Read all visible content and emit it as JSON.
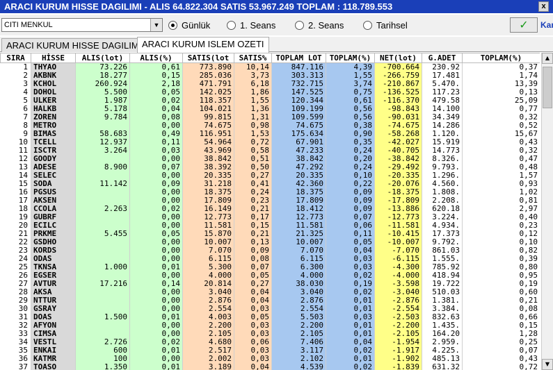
{
  "title": "ARACI KURUM HISSE DAGILIMI - ALIS 64.822.304  SATIS 53.967.249  TOPLAM : 118.789.553",
  "close_label": "x",
  "filter": {
    "broker": "CITI MENKUL",
    "radios": [
      {
        "label": "Günlük",
        "checked": true
      },
      {
        "label": "1. Seans",
        "checked": false
      },
      {
        "label": "2. Seans",
        "checked": false
      },
      {
        "label": "Tarihsel",
        "checked": false
      }
    ],
    "ok_icon": "✓",
    "more_label": "Kar"
  },
  "tabs": [
    {
      "label": "ARACI KURUM HISSE DAGILIMI",
      "active": false
    },
    {
      "label": "ARACI KURUM ISLEM OZETI",
      "active": true
    }
  ],
  "columns": [
    "SIRA",
    "HİSSE",
    "ALIS(lot)",
    "ALIS(%)",
    "SATIS(lot",
    "SATIS%",
    "TOPLAM LOT",
    "TOPLAM(%)",
    "NET(lot)",
    "G.ADET",
    "TOPLAM(%)"
  ],
  "colors": {
    "titlebar": "#1a3fb8",
    "alis": "#ccffcc",
    "satis": "#ffdab9",
    "toplam": "#a7c8f0",
    "net": "#ffff88"
  },
  "rows": [
    [
      "1",
      "THYAO",
      "73.226",
      "0,61",
      "773.890",
      "10,14",
      "847.116",
      "4,39",
      "-700.664",
      "230.92",
      "0,37"
    ],
    [
      "2",
      "AKBNK",
      "18.277",
      "0,15",
      "285.036",
      "3,73",
      "303.313",
      "1,55",
      "-266.759",
      "17.481",
      "1,74"
    ],
    [
      "3",
      "KCHOL",
      "260.924",
      "2,18",
      "471.791",
      "6,18",
      "732.715",
      "3,74",
      "-210.867",
      "5.470.",
      "13,39"
    ],
    [
      "4",
      "DOHOL",
      "5.500",
      "0,05",
      "142.025",
      "1,86",
      "147.525",
      "0,75",
      "-136.525",
      "117.23",
      "0,13"
    ],
    [
      "5",
      "ULKER",
      "1.987",
      "0,02",
      "118.357",
      "1,55",
      "120.344",
      "0,61",
      "-116.370",
      "479.58",
      "25,09"
    ],
    [
      "6",
      "HALKB",
      "5.178",
      "0,04",
      "104.021",
      "1,36",
      "109.199",
      "0,56",
      "-98.843",
      "14.100",
      "0,77"
    ],
    [
      "7",
      "ZOREN",
      "9.784",
      "0,08",
      "99.815",
      "1,31",
      "109.599",
      "0,56",
      "-90.031",
      "34.349",
      "0,32"
    ],
    [
      "8",
      "METRO",
      "",
      "0,00",
      "74.675",
      "0,98",
      "74.675",
      "0,38",
      "-74.675",
      "14.286",
      "0,52"
    ],
    [
      "9",
      "BIMAS",
      "58.683",
      "0,49",
      "116.951",
      "1,53",
      "175.634",
      "0,90",
      "-58.268",
      "1.120.",
      "15,67"
    ],
    [
      "10",
      "TCELL",
      "12.937",
      "0,11",
      "54.964",
      "0,72",
      "67.901",
      "0,35",
      "-42.027",
      "15.919",
      "0,43"
    ],
    [
      "11",
      "ISCTR",
      "3.264",
      "0,03",
      "43.969",
      "0,58",
      "47.233",
      "0,24",
      "-40.705",
      "14.773",
      "0,32"
    ],
    [
      "12",
      "GOODY",
      "",
      "0,00",
      "38.842",
      "0,51",
      "38.842",
      "0,20",
      "-38.842",
      "8.326.",
      "0,47"
    ],
    [
      "13",
      "ADESE",
      "8.900",
      "0,07",
      "38.392",
      "0,50",
      "47.292",
      "0,24",
      "-29.492",
      "9.793.",
      "0,48"
    ],
    [
      "14",
      "SELEC",
      "",
      "0,00",
      "20.335",
      "0,27",
      "20.335",
      "0,10",
      "-20.335",
      "1.296.",
      "1,57"
    ],
    [
      "15",
      "SODA",
      "11.142",
      "0,09",
      "31.218",
      "0,41",
      "42.360",
      "0,22",
      "-20.076",
      "4.560.",
      "0,93"
    ],
    [
      "16",
      "PGSUS",
      "",
      "0,00",
      "18.375",
      "0,24",
      "18.375",
      "0,09",
      "-18.375",
      "1.808.",
      "1,02"
    ],
    [
      "17",
      "AKSEN",
      "",
      "0,00",
      "17.809",
      "0,23",
      "17.809",
      "0,09",
      "-17.809",
      "2.208.",
      "0,81"
    ],
    [
      "18",
      "CCOLA",
      "2.263",
      "0,02",
      "16.149",
      "0,21",
      "18.412",
      "0,09",
      "-13.886",
      "620.18",
      "2,97"
    ],
    [
      "19",
      "GUBRF",
      "",
      "0,00",
      "12.773",
      "0,17",
      "12.773",
      "0,07",
      "-12.773",
      "3.224.",
      "0,40"
    ],
    [
      "20",
      "ECILC",
      "",
      "0,00",
      "11.581",
      "0,15",
      "11.581",
      "0,06",
      "-11.581",
      "4.934.",
      "0,23"
    ],
    [
      "21",
      "PRKME",
      "5.455",
      "0,05",
      "15.870",
      "0,21",
      "21.325",
      "0,11",
      "-10.415",
      "17.373",
      "0,12"
    ],
    [
      "22",
      "GSDHO",
      "",
      "0,00",
      "10.007",
      "0,13",
      "10.007",
      "0,05",
      "-10.007",
      "9.792.",
      "0,10"
    ],
    [
      "23",
      "KORDS",
      "",
      "0,00",
      "7.070",
      "0,09",
      "7.070",
      "0,04",
      "-7.070",
      "861.03",
      "0,82"
    ],
    [
      "24",
      "ODAS",
      "",
      "0,00",
      "6.115",
      "0,08",
      "6.115",
      "0,03",
      "-6.115",
      "1.555.",
      "0,39"
    ],
    [
      "25",
      "TKNSA",
      "1.000",
      "0,01",
      "5.300",
      "0,07",
      "6.300",
      "0,03",
      "-4.300",
      "785.92",
      "0,80"
    ],
    [
      "26",
      "EGSER",
      "",
      "0,00",
      "4.000",
      "0,05",
      "4.000",
      "0,02",
      "-4.000",
      "418.94",
      "0,95"
    ],
    [
      "27",
      "AVTUR",
      "17.216",
      "0,14",
      "20.814",
      "0,27",
      "38.030",
      "0,19",
      "-3.598",
      "19.722",
      "0,19"
    ],
    [
      "28",
      "AKSA",
      "",
      "0,00",
      "3.040",
      "0,04",
      "3.040",
      "0,02",
      "-3.040",
      "510.03",
      "0,60"
    ],
    [
      "29",
      "NTTUR",
      "",
      "0,00",
      "2.876",
      "0,04",
      "2.876",
      "0,01",
      "-2.876",
      "1.381.",
      "0,21"
    ],
    [
      "30",
      "GSRAY",
      "",
      "0,00",
      "2.554",
      "0,03",
      "2.554",
      "0,01",
      "-2.554",
      "3.384.",
      "0,08"
    ],
    [
      "31",
      "DOAS",
      "1.500",
      "0,01",
      "4.003",
      "0,05",
      "5.503",
      "0,03",
      "-2.503",
      "832.63",
      "0,66"
    ],
    [
      "32",
      "AFYON",
      "",
      "0,00",
      "2.200",
      "0,03",
      "2.200",
      "0,01",
      "-2.200",
      "1.435.",
      "0,15"
    ],
    [
      "33",
      "CIMSA",
      "",
      "0,00",
      "2.105",
      "0,03",
      "2.105",
      "0,01",
      "-2.105",
      "164.20",
      "1,28"
    ],
    [
      "34",
      "VESTL",
      "2.726",
      "0,02",
      "4.680",
      "0,06",
      "7.406",
      "0,04",
      "-1.954",
      "2.959.",
      "0,25"
    ],
    [
      "35",
      "ENKAI",
      "600",
      "0,01",
      "2.517",
      "0,03",
      "3.117",
      "0,02",
      "-1.917",
      "4.225.",
      "0,07"
    ],
    [
      "36",
      "KATMR",
      "100",
      "0,00",
      "2.002",
      "0,03",
      "2.102",
      "0,01",
      "-1.902",
      "485.13",
      "0,43"
    ],
    [
      "37",
      "TOASO",
      "1.350",
      "0,01",
      "3.189",
      "0,04",
      "4.539",
      "0,02",
      "-1.839",
      "631.32",
      "0,72"
    ]
  ]
}
